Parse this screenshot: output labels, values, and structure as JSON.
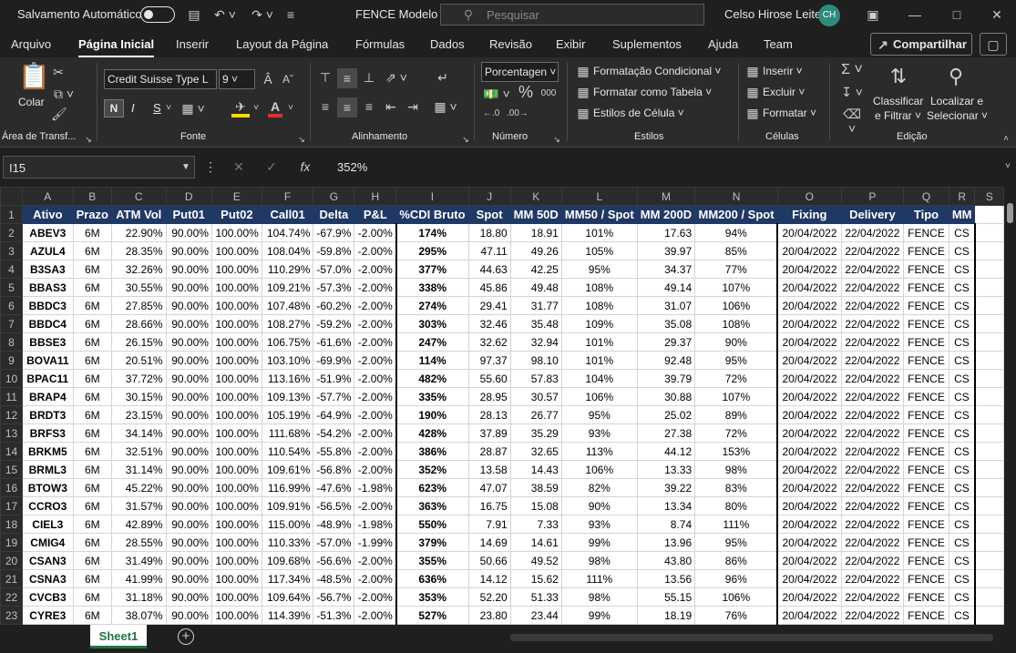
{
  "titlebar": {
    "autosave": "Salvamento Automático",
    "filename": "FENCE Modelo",
    "search": "Pesquisar",
    "user": "Celso Hirose Leite",
    "initials": "CH"
  },
  "menu": [
    "Arquivo",
    "Página Inicial",
    "Inserir",
    "Layout da Página",
    "Fórmulas",
    "Dados",
    "Revisão",
    "Exibir",
    "Suplementos",
    "Ajuda",
    "Team"
  ],
  "share": "Compartilhar",
  "ribbon": {
    "paste": "Colar",
    "clipboard": "Área de Transf...",
    "font_name": "Credit Suisse Type L",
    "font_size": "9",
    "bold": "N",
    "italic": "I",
    "underline": "S",
    "font_group": "Fonte",
    "align_group": "Alinhamento",
    "number_format": "Porcentagen",
    "number_group": "Número",
    "cond_format": "Formatação Condicional",
    "format_table": "Formatar como Tabela",
    "cell_styles": "Estilos de Célula",
    "styles_group": "Estilos",
    "insert": "Inserir",
    "delete": "Excluir",
    "format": "Formatar",
    "cells_group": "Células",
    "sort1": "Classificar",
    "sort2": "e Filtrar",
    "find1": "Localizar e",
    "find2": "Selecionar",
    "edit_group": "Edição"
  },
  "formula_bar": {
    "cell_ref": "I15",
    "value": "352%",
    "fx": "fx"
  },
  "sheet": {
    "tab": "Sheet1",
    "col_letters": [
      "A",
      "B",
      "C",
      "D",
      "E",
      "F",
      "G",
      "H",
      "I",
      "J",
      "K",
      "L",
      "M",
      "N",
      "O",
      "P",
      "Q",
      "R",
      "S"
    ],
    "headers": [
      "Ativo",
      "Prazo",
      "ATM Vol",
      "Put01",
      "Put02",
      "Call01",
      "Delta",
      "P&L",
      "%CDI Bruto",
      "Spot",
      "MM 50D",
      "MM50 / Spot",
      "MM 200D",
      "MM200 / Spot",
      "Fixing",
      "Delivery",
      "Tipo",
      "MM"
    ],
    "rows": [
      [
        "ABEV3",
        "6M",
        "22.90%",
        "90.00%",
        "100.00%",
        "104.74%",
        "-67.9%",
        "-2.00%",
        "174%",
        "18.80",
        "18.91",
        "101%",
        "17.63",
        "94%",
        "20/04/2022",
        "22/04/2022",
        "FENCE",
        "CS"
      ],
      [
        "AZUL4",
        "6M",
        "28.35%",
        "90.00%",
        "100.00%",
        "108.04%",
        "-59.8%",
        "-2.00%",
        "295%",
        "47.11",
        "49.26",
        "105%",
        "39.97",
        "85%",
        "20/04/2022",
        "22/04/2022",
        "FENCE",
        "CS"
      ],
      [
        "B3SA3",
        "6M",
        "32.26%",
        "90.00%",
        "100.00%",
        "110.29%",
        "-57.0%",
        "-2.00%",
        "377%",
        "44.63",
        "42.25",
        "95%",
        "34.37",
        "77%",
        "20/04/2022",
        "22/04/2022",
        "FENCE",
        "CS"
      ],
      [
        "BBAS3",
        "6M",
        "30.55%",
        "90.00%",
        "100.00%",
        "109.21%",
        "-57.3%",
        "-2.00%",
        "338%",
        "45.86",
        "49.48",
        "108%",
        "49.14",
        "107%",
        "20/04/2022",
        "22/04/2022",
        "FENCE",
        "CS"
      ],
      [
        "BBDC3",
        "6M",
        "27.85%",
        "90.00%",
        "100.00%",
        "107.48%",
        "-60.2%",
        "-2.00%",
        "274%",
        "29.41",
        "31.77",
        "108%",
        "31.07",
        "106%",
        "20/04/2022",
        "22/04/2022",
        "FENCE",
        "CS"
      ],
      [
        "BBDC4",
        "6M",
        "28.66%",
        "90.00%",
        "100.00%",
        "108.27%",
        "-59.2%",
        "-2.00%",
        "303%",
        "32.46",
        "35.48",
        "109%",
        "35.08",
        "108%",
        "20/04/2022",
        "22/04/2022",
        "FENCE",
        "CS"
      ],
      [
        "BBSE3",
        "6M",
        "26.15%",
        "90.00%",
        "100.00%",
        "106.75%",
        "-61.6%",
        "-2.00%",
        "247%",
        "32.62",
        "32.94",
        "101%",
        "29.37",
        "90%",
        "20/04/2022",
        "22/04/2022",
        "FENCE",
        "CS"
      ],
      [
        "BOVA11",
        "6M",
        "20.51%",
        "90.00%",
        "100.00%",
        "103.10%",
        "-69.9%",
        "-2.00%",
        "114%",
        "97.37",
        "98.10",
        "101%",
        "92.48",
        "95%",
        "20/04/2022",
        "22/04/2022",
        "FENCE",
        "CS"
      ],
      [
        "BPAC11",
        "6M",
        "37.72%",
        "90.00%",
        "100.00%",
        "113.16%",
        "-51.9%",
        "-2.00%",
        "482%",
        "55.60",
        "57.83",
        "104%",
        "39.79",
        "72%",
        "20/04/2022",
        "22/04/2022",
        "FENCE",
        "CS"
      ],
      [
        "BRAP4",
        "6M",
        "30.15%",
        "90.00%",
        "100.00%",
        "109.13%",
        "-57.7%",
        "-2.00%",
        "335%",
        "28.95",
        "30.57",
        "106%",
        "30.88",
        "107%",
        "20/04/2022",
        "22/04/2022",
        "FENCE",
        "CS"
      ],
      [
        "BRDT3",
        "6M",
        "23.15%",
        "90.00%",
        "100.00%",
        "105.19%",
        "-64.9%",
        "-2.00%",
        "190%",
        "28.13",
        "26.77",
        "95%",
        "25.02",
        "89%",
        "20/04/2022",
        "22/04/2022",
        "FENCE",
        "CS"
      ],
      [
        "BRFS3",
        "6M",
        "34.14%",
        "90.00%",
        "100.00%",
        "111.68%",
        "-54.2%",
        "-2.00%",
        "428%",
        "37.89",
        "35.29",
        "93%",
        "27.38",
        "72%",
        "20/04/2022",
        "22/04/2022",
        "FENCE",
        "CS"
      ],
      [
        "BRKM5",
        "6M",
        "32.51%",
        "90.00%",
        "100.00%",
        "110.54%",
        "-55.8%",
        "-2.00%",
        "386%",
        "28.87",
        "32.65",
        "113%",
        "44.12",
        "153%",
        "20/04/2022",
        "22/04/2022",
        "FENCE",
        "CS"
      ],
      [
        "BRML3",
        "6M",
        "31.14%",
        "90.00%",
        "100.00%",
        "109.61%",
        "-56.8%",
        "-2.00%",
        "352%",
        "13.58",
        "14.43",
        "106%",
        "13.33",
        "98%",
        "20/04/2022",
        "22/04/2022",
        "FENCE",
        "CS"
      ],
      [
        "BTOW3",
        "6M",
        "45.22%",
        "90.00%",
        "100.00%",
        "116.99%",
        "-47.6%",
        "-1.98%",
        "623%",
        "47.07",
        "38.59",
        "82%",
        "39.22",
        "83%",
        "20/04/2022",
        "22/04/2022",
        "FENCE",
        "CS"
      ],
      [
        "CCRO3",
        "6M",
        "31.57%",
        "90.00%",
        "100.00%",
        "109.91%",
        "-56.5%",
        "-2.00%",
        "363%",
        "16.75",
        "15.08",
        "90%",
        "13.34",
        "80%",
        "20/04/2022",
        "22/04/2022",
        "FENCE",
        "CS"
      ],
      [
        "CIEL3",
        "6M",
        "42.89%",
        "90.00%",
        "100.00%",
        "115.00%",
        "-48.9%",
        "-1.98%",
        "550%",
        "7.91",
        "7.33",
        "93%",
        "8.74",
        "111%",
        "20/04/2022",
        "22/04/2022",
        "FENCE",
        "CS"
      ],
      [
        "CMIG4",
        "6M",
        "28.55%",
        "90.00%",
        "100.00%",
        "110.33%",
        "-57.0%",
        "-1.99%",
        "379%",
        "14.69",
        "14.61",
        "99%",
        "13.96",
        "95%",
        "20/04/2022",
        "22/04/2022",
        "FENCE",
        "CS"
      ],
      [
        "CSAN3",
        "6M",
        "31.49%",
        "90.00%",
        "100.00%",
        "109.68%",
        "-56.6%",
        "-2.00%",
        "355%",
        "50.66",
        "49.52",
        "98%",
        "43.80",
        "86%",
        "20/04/2022",
        "22/04/2022",
        "FENCE",
        "CS"
      ],
      [
        "CSNA3",
        "6M",
        "41.99%",
        "90.00%",
        "100.00%",
        "117.34%",
        "-48.5%",
        "-2.00%",
        "636%",
        "14.12",
        "15.62",
        "111%",
        "13.56",
        "96%",
        "20/04/2022",
        "22/04/2022",
        "FENCE",
        "CS"
      ],
      [
        "CVCB3",
        "6M",
        "31.18%",
        "90.00%",
        "100.00%",
        "109.64%",
        "-56.7%",
        "-2.00%",
        "353%",
        "52.20",
        "51.33",
        "98%",
        "55.15",
        "106%",
        "20/04/2022",
        "22/04/2022",
        "FENCE",
        "CS"
      ],
      [
        "CYRE3",
        "6M",
        "38.07%",
        "90.00%",
        "100.00%",
        "114.39%",
        "-51.3%",
        "-2.00%",
        "527%",
        "23.80",
        "23.44",
        "99%",
        "18.19",
        "76%",
        "20/04/2022",
        "22/04/2022",
        "FENCE",
        "CS"
      ]
    ]
  }
}
